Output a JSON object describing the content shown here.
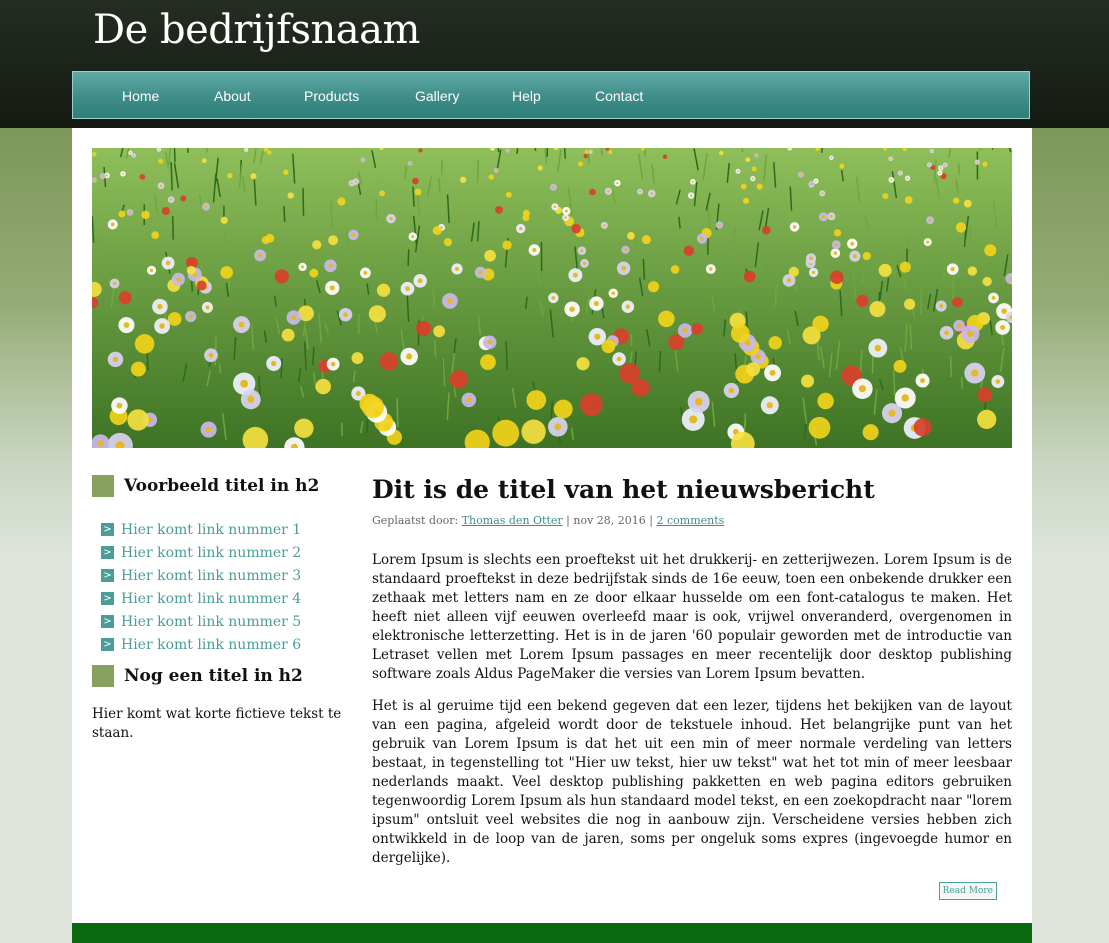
{
  "site": {
    "title": "De bedrijfsnaam"
  },
  "nav": [
    {
      "label": "Home"
    },
    {
      "label": "About"
    },
    {
      "label": "Products"
    },
    {
      "label": "Gallery"
    },
    {
      "label": "Help"
    },
    {
      "label": "Contact"
    }
  ],
  "sidebar": {
    "heading1": "Voorbeeld titel in h2",
    "links": [
      "Hier komt link nummer 1",
      "Hier komt link nummer 2",
      "Hier komt link nummer 3",
      "Hier komt link nummer 4",
      "Hier komt link nummer 5",
      "Hier komt link nummer 6"
    ],
    "heading2": "Nog een titel in h2",
    "text": "Hier komt wat korte fictieve tekst te staan."
  },
  "article": {
    "title": "Dit is de titel van het nieuwsbericht",
    "meta_prefix": "Geplaatst door:",
    "author": "Thomas den Otter",
    "date": "nov 28, 2016",
    "comments": "2 comments",
    "paragraph1": "Lorem Ipsum is slechts een proeftekst uit het drukkerij- en zetterijwezen. Lorem Ipsum is de standaard proeftekst in deze bedrijfstak sinds de 16e eeuw, toen een onbekende drukker een zethaak met letters nam en ze door elkaar husselde om een font-catalogus te maken. Het heeft niet alleen vijf eeuwen overleefd maar is ook, vrijwel onveranderd, overgenomen in elektronische letterzetting. Het is in de jaren '60 populair geworden met de introductie van Letraset vellen met Lorem Ipsum passages en meer recentelijk door desktop publishing software zoals Aldus PageMaker die versies van Lorem Ipsum bevatten.",
    "paragraph2": "Het is al geruime tijd een bekend gegeven dat een lezer, tijdens het bekijken van de layout van een pagina, afgeleid wordt door de tekstuele inhoud. Het belangrijke punt van het gebruik van Lorem Ipsum is dat het uit een min of meer normale verdeling van letters bestaat, in tegenstelling tot \"Hier uw tekst, hier uw tekst\" wat het tot min of meer leesbaar nederlands maakt. Veel desktop publishing pakketten en web pagina editors gebruiken tegenwoordig Lorem Ipsum als hun standaard model tekst, en een zoekopdracht naar \"lorem ipsum\" ontsluit veel websites die nog in aanbouw zijn. Verscheidene versies hebben zich ontwikkeld in de loop van de jaren, soms per ongeluk soms expres (ingevoegde humor en dergelijke).",
    "read_more": "Read More"
  },
  "colors": {
    "accent": "#4a9d98",
    "nav": "#3e8d89",
    "heading_square": "#87a15f",
    "footer": "#0a6a10"
  }
}
